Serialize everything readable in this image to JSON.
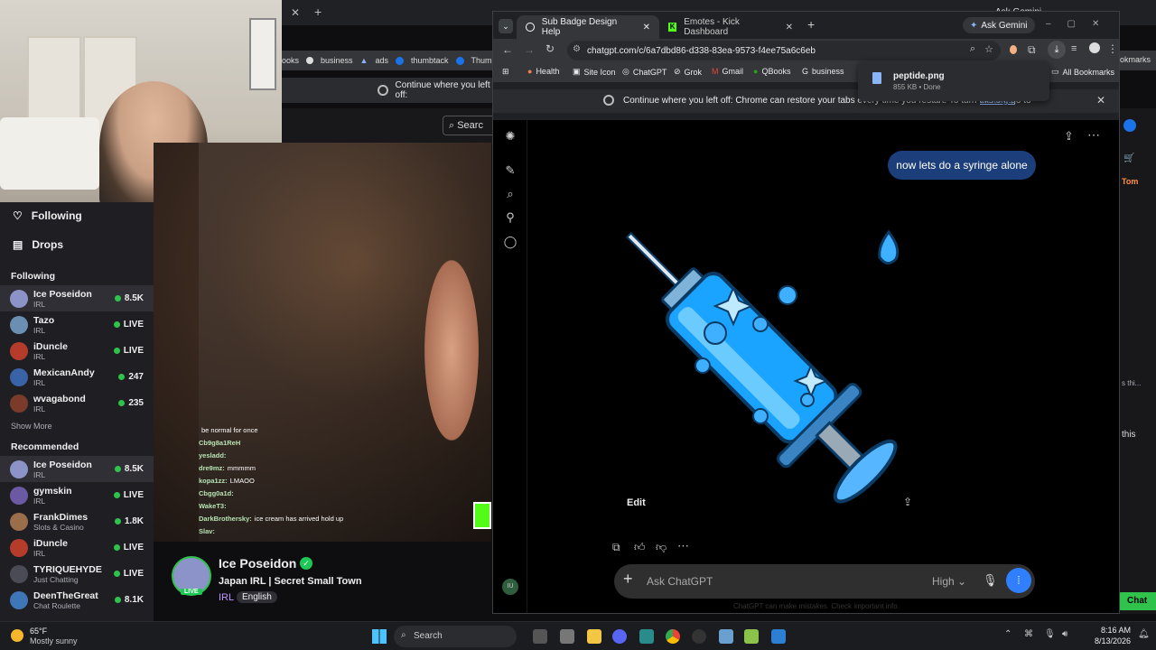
{
  "bg_browser": {
    "bookmarks": [
      "ooks",
      "business",
      "ads",
      "thumbtack",
      "Thumbta"
    ],
    "restore_text": "Continue where you left off:",
    "search_label": "Searc",
    "bookmarks_right": "okmarks",
    "right_user": "Tom",
    "right_snippet1": "s thi...",
    "right_snippet2": "this",
    "right_chat_btn": "Chat"
  },
  "twitch": {
    "nav": [
      {
        "label": "Following",
        "icon": "heart-icon"
      },
      {
        "label": "Drops",
        "icon": "drops-icon"
      }
    ],
    "following_title": "Following",
    "following": [
      {
        "name": "Ice Poseidon",
        "cat": "IRL",
        "status": "8.5K",
        "sel": true,
        "color": "#8b93c9"
      },
      {
        "name": "Tazo",
        "cat": "IRL",
        "status": "LIVE",
        "color": "#6a8fb3"
      },
      {
        "name": "iDuncle",
        "cat": "IRL",
        "status": "LIVE",
        "color": "#b53b2b"
      },
      {
        "name": "MexicanAndy",
        "cat": "IRL",
        "status": "247",
        "color": "#3a62a6"
      },
      {
        "name": "wvagabond",
        "cat": "IRL",
        "status": "235",
        "color": "#7a3b2b"
      }
    ],
    "show_more": "Show More",
    "recommended_title": "Recommended",
    "recommended": [
      {
        "name": "Ice Poseidon",
        "cat": "IRL",
        "status": "8.5K",
        "sel": true,
        "color": "#8b93c9"
      },
      {
        "name": "gymskin",
        "cat": "IRL",
        "status": "LIVE",
        "color": "#6b5aa3"
      },
      {
        "name": "FrankDimes",
        "cat": "Slots & Casino",
        "status": "1.8K",
        "color": "#9a6d4b"
      },
      {
        "name": "iDuncle",
        "cat": "IRL",
        "status": "LIVE",
        "color": "#b53b2b"
      },
      {
        "name": "TYRIQUEHYDE",
        "cat": "Just Chatting",
        "status": "LIVE",
        "color": "#4b4b55"
      },
      {
        "name": "DeenTheGreat",
        "cat": "Chat Roulette",
        "status": "8.1K",
        "color": "#3f76b8"
      }
    ],
    "chat": [
      {
        "user": "",
        "msg": "be normal for once"
      },
      {
        "user": "Cb9g8a1ReH",
        "msg": ""
      },
      {
        "user": "yesladd:",
        "msg": ""
      },
      {
        "user": "dre9mz:",
        "msg": "mmmmm"
      },
      {
        "user": "kopa1zz:",
        "msg": "LMAOO"
      },
      {
        "user": "Cbgg0a1d:",
        "msg": ""
      },
      {
        "user": "WakeT3:",
        "msg": ""
      },
      {
        "user": "DarkBrothersky:",
        "msg": "ice cream has arrived hold up"
      },
      {
        "user": "Slav:",
        "msg": ""
      }
    ],
    "channel": {
      "name": "Ice Poseidon",
      "title": "Japan IRL | Secret Small Town",
      "category": "IRL",
      "tag": "English",
      "live": "LIVE"
    }
  },
  "chrome": {
    "tabs": [
      {
        "label": "Sub Badge Design Help",
        "icon": "chatgpt-icon",
        "active": true
      },
      {
        "label": "Emotes - Kick Dashboard",
        "icon": "kick-icon",
        "active": false
      }
    ],
    "ask_gemini": "Ask Gemini",
    "url": "chatgpt.com/c/6a7dbd86-d338-83ea-9573-f4ee75a6c6eb",
    "bookmarks": [
      {
        "label": "Health",
        "icon": "health-icon"
      },
      {
        "label": "Site Icon",
        "icon": "site-icon"
      },
      {
        "label": "ChatGPT",
        "icon": "chatgpt-icon"
      },
      {
        "label": "Grok",
        "icon": "grok-icon"
      },
      {
        "label": "Gmail",
        "icon": "gmail-icon"
      },
      {
        "label": "QBooks",
        "icon": "qbooks-icon"
      },
      {
        "label": "business",
        "icon": "google-icon"
      }
    ],
    "all_bookmarks": "All Bookmarks",
    "restore": "Continue where you left off: Chrome can restore your tabs every time you restart. To turn this on, go to",
    "restore_link": "Settings.",
    "download": {
      "file": "peptide.png",
      "meta": "855 KB • Done"
    }
  },
  "chatgpt": {
    "user_message": "now lets do a syringe alone",
    "image_edit": "Edit",
    "composer_placeholder": "Ask ChatGPT",
    "model_mode": "High",
    "footer": "ChatGPT can make mistakes. Check important info.",
    "avatar_initials": "IU"
  },
  "taskbar": {
    "weather_temp": "65°F",
    "weather_desc": "Mostly sunny",
    "search": "Search",
    "time": "8:16 AM",
    "date": "8/13/2026"
  },
  "colors": {
    "twitch_live": "#30c34b",
    "chatgpt_bubble": "#1c3e7a",
    "kick_green": "#53fc18",
    "twitch_verified": "#1ec857"
  }
}
